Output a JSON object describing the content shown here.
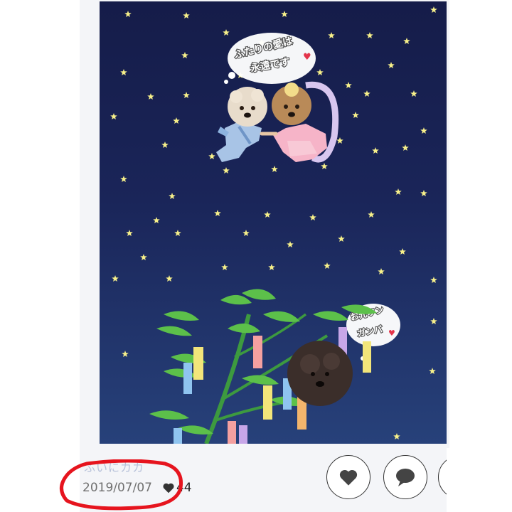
{
  "post": {
    "username": "ふいにカカ",
    "date": "2019/07/07",
    "like_count": "44",
    "image": {
      "bubble_top_line1": "ふたりの愛は",
      "bubble_top_line2": "永遠です",
      "bubble_bottom_line1": "お元ワン",
      "bubble_bottom_line2": "ガンバ",
      "heart_symbol": "♥"
    }
  },
  "actions": {
    "like_icon": "heart-icon",
    "comment_icon": "comment-icon",
    "more_icon": "more-icon"
  },
  "colors": {
    "sky_top": "#151c49",
    "sky_bottom": "#27417a",
    "star": "#f7f08a",
    "annotation": "#e6141e",
    "heart_red": "#e3344a"
  }
}
